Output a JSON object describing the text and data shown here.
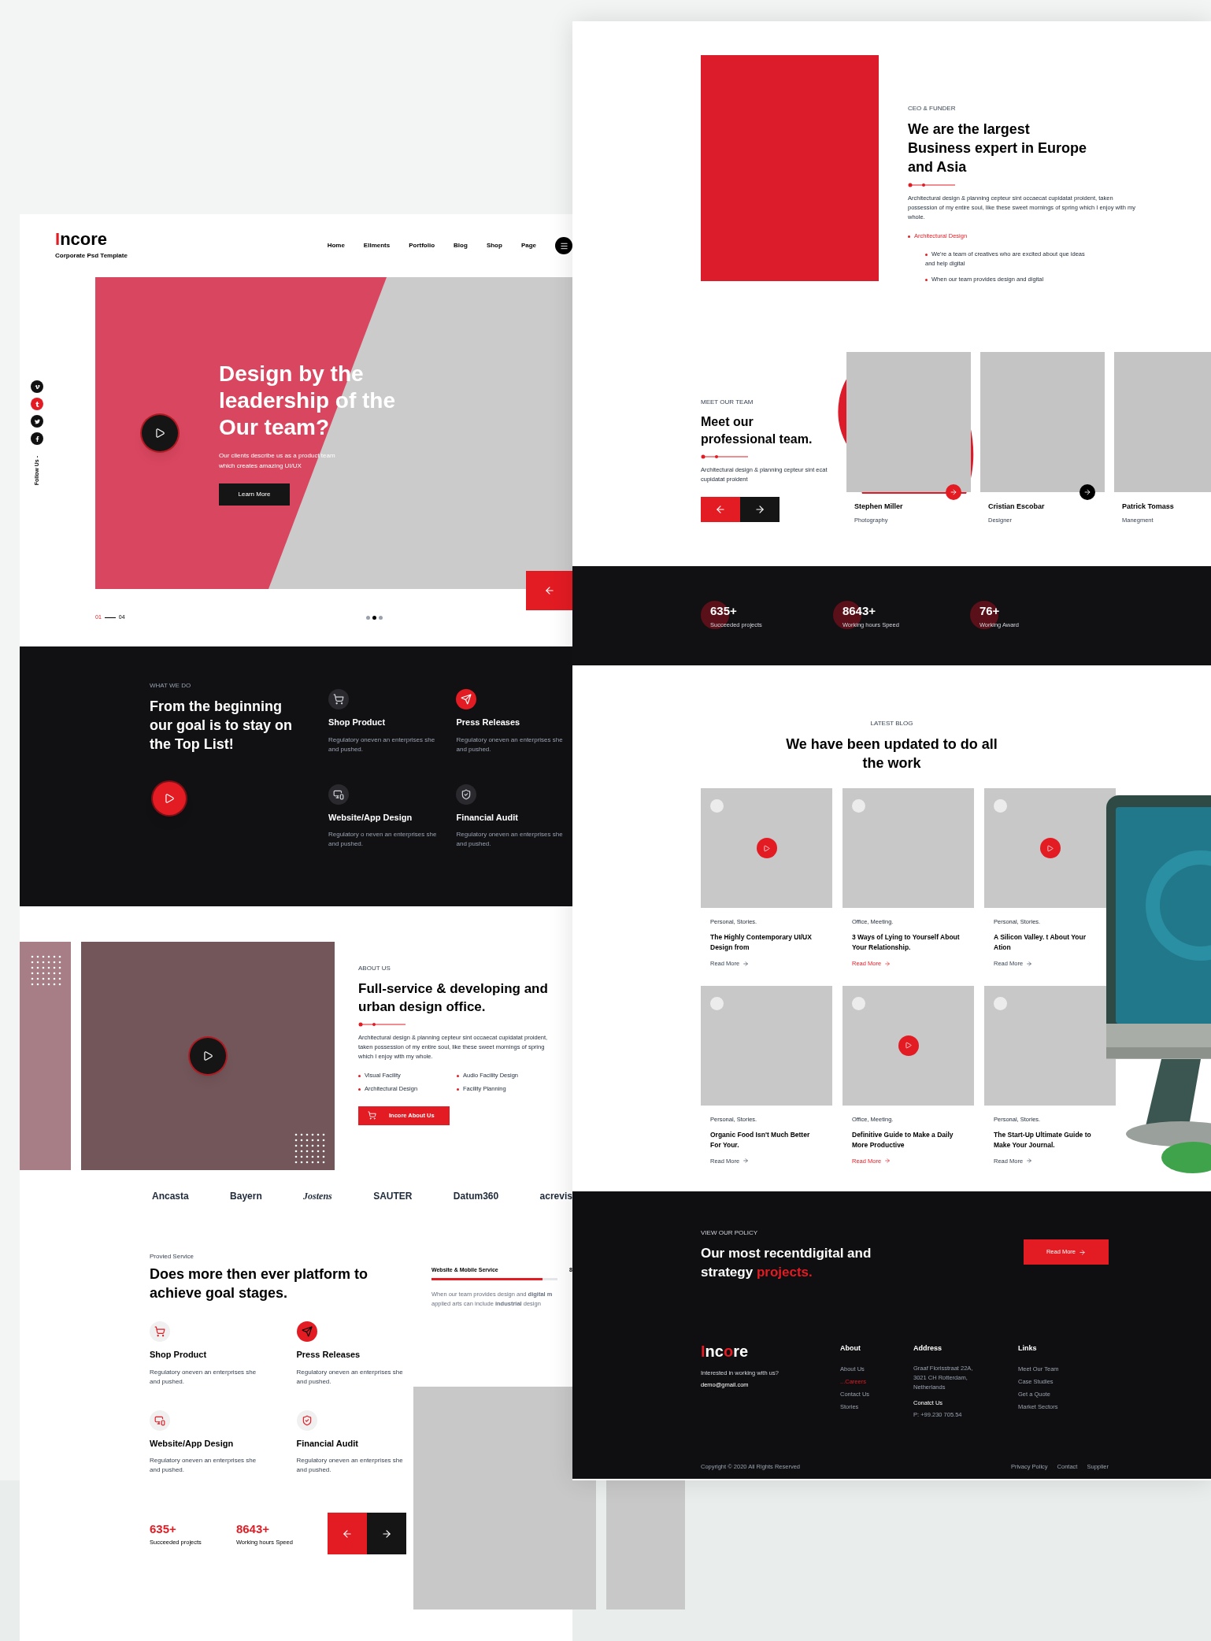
{
  "left_page": {
    "header": {
      "logo": "Incore",
      "tagline": "Corporate Psd Template",
      "nav": [
        "Home",
        "Ellments",
        "Portfolio",
        "Blog",
        "Shop",
        "Page"
      ]
    },
    "social": {
      "label": "Follow Us -",
      "icons": [
        {
          "kind": "vimeo",
          "color": "#111111"
        },
        {
          "kind": "tumblr",
          "color": "#e31b23"
        },
        {
          "kind": "twitter",
          "color": "#111111"
        },
        {
          "kind": "facebook",
          "color": "#111111"
        }
      ]
    },
    "hero": {
      "title": "Design by the leadership of the Our team?",
      "text": "Our clients describe us as a product team which creates amazing UI/UX",
      "button": "Learn More",
      "pager_current": "01",
      "pager_total": "04",
      "dots": [
        {
          "selected": false
        },
        {
          "selected": true
        },
        {
          "selected": false
        }
      ]
    },
    "what_we_do": {
      "eyebrow": "WHAT WE DO",
      "title": "From the beginning our goal is to stay on the Top List!",
      "services": [
        {
          "kind": "cart",
          "title": "Shop Product",
          "text": "Regulatory oneven an enterprises she and pushed.",
          "selected": false
        },
        {
          "kind": "plane",
          "title": "Press Releases",
          "text": "Regulatory oneven an enterprises she and pushed.",
          "selected": true
        },
        {
          "kind": "devices",
          "title": "Website/App Design",
          "text": "Regulatory o neven an enterprises she and pushed.",
          "selected": false
        },
        {
          "kind": "shield",
          "title": "Financial Audit",
          "text": "Regulatory oneven an enterprises she and pushed.",
          "selected": false
        }
      ]
    },
    "about": {
      "eyebrow": "ABOUT US",
      "title": "Full-service & developing and urban design office.",
      "text": "Architectural design & planning cepteur sint occaecat cupidatat proident, taken possession of my entire soul, like these sweet mornings of spring which I enjoy with my whole.",
      "bullets": [
        "Visual Facility",
        "Audio Facility Design",
        "Architectural Design",
        "Facility Planning"
      ],
      "button": "Incore About Us"
    },
    "partners": [
      "Ancasta",
      "Bayern",
      "Jostens",
      "SAUTER",
      "Datum360",
      "acrevis"
    ],
    "service": {
      "eyebrow": "Provied Service",
      "title": "Does more then ever platform to achieve goal stages.",
      "services": [
        {
          "kind": "cart",
          "title": "Shop Product",
          "text": "Regulatory oneven an enterprises she and pushed.",
          "selected": false
        },
        {
          "kind": "plane",
          "title": "Press Releases",
          "text": "Regulatory oneven an enterprises she and pushed.",
          "selected": true
        },
        {
          "kind": "devices",
          "title": "Website/App Design",
          "text": "Regulatory oneven an enterprises she and pushed.",
          "selected": false
        },
        {
          "kind": "shield",
          "title": "Financial Audit",
          "text": "Regulatory oneven an enterprises she and pushed.",
          "selected": false
        }
      ],
      "progress": {
        "label": "Website & Mobile Service",
        "reading": "8",
        "level": 0.88
      },
      "progress_text": "When our team provides design and **digital m** applied arts can include **industrial** design",
      "stats": [
        {
          "value": "635+",
          "label": "Succeeded projects"
        },
        {
          "value": "8643+",
          "label": "Working hours Speed"
        }
      ]
    }
  },
  "right_page": {
    "ceo": {
      "eyebrow": "CEO & FUNDER",
      "title": "We are the largest Business expert in Europe and Asia",
      "text": "Architectural design & planning cepteur sint occaecat cupidatat proident, taken possession of my entire soul, like these sweet mornings of spring which I enjoy with my whole.",
      "list": [
        {
          "text": "Architectural Design",
          "selected": true,
          "children": [
            {
              "text": "We're a team of creatives who are excited about que ideas and help digital",
              "selected": false
            },
            {
              "text": "When our team provides design and digital",
              "selected": false
            }
          ]
        }
      ]
    },
    "team": {
      "eyebrow": "MEET OUR TEAM",
      "title": "Meet our professional team.",
      "text": "Architectural design & planning cepteur sint ecat cupidatat proident",
      "members": [
        {
          "name": "Stephen Miller",
          "role": "Photography",
          "selected": true
        },
        {
          "name": "Cristian Escobar",
          "role": "Designer",
          "selected": false
        },
        {
          "name": "Patrick Tomass",
          "role": "Manegment"
        }
      ]
    },
    "stats": [
      {
        "value": "635+",
        "label": "Succeeded projects"
      },
      {
        "value": "8643+",
        "label": "Working hours Speed"
      },
      {
        "value": "76+",
        "label": "Working Award"
      }
    ],
    "blog": {
      "eyebrow": "LATEST BLOG",
      "title": "We have been updated to do all the work",
      "posts": [
        {
          "category": "Personal, Stories.",
          "title": "The Highly Contemporary UI/UX Design from",
          "read_more": "Read More",
          "video": true,
          "selected": false
        },
        {
          "category": "Office, Meeting.",
          "title": "3 Ways of Lying to Yourself About Your Relationship.",
          "read_more": "Read More",
          "video": false,
          "selected": true
        },
        {
          "category": "Personal, Stories.",
          "title": "A Silicon Valley. t About Your Ation",
          "read_more": "Read More",
          "video": true,
          "selected": false
        },
        {
          "category": "Personal, Stories.",
          "title": "Organic Food Isn't Much Better For Your.",
          "read_more": "Read More",
          "video": false,
          "selected": false
        },
        {
          "category": "Office, Meeting.",
          "title": "Definitive Guide to Make a Daily More Productive",
          "read_more": "Read More",
          "video": true,
          "selected": true
        },
        {
          "category": "Personal, Stories.",
          "title": "The Start-Up Ultimate Guide to Make Your Journal.",
          "read_more": "Read More",
          "video": false,
          "selected": false
        }
      ]
    },
    "policy": {
      "eyebrow": "VIEW OUR POLICY",
      "title": "Our most recentdigital and strategy",
      "title_accent": "projects.",
      "button": "Read More"
    },
    "footer": {
      "logo": "Incore",
      "text": "Interested in working with us?",
      "email": "demo@gmail.com",
      "about": {
        "heading": "About",
        "links": [
          {
            "text": "About Us",
            "selected": false
          },
          {
            "text": "...Careers",
            "selected": true
          },
          {
            "text": "Contact Us",
            "selected": false
          },
          {
            "text": "Stories",
            "selected": false
          }
        ]
      },
      "address": {
        "heading": "Address",
        "lines": "Graaf Florisstraat 22A, 3021 CH Rotterdam, Netherlands",
        "contact_heading": "Conatct Us",
        "phone": "P: +99.230 705.54"
      },
      "links": {
        "heading": "Links",
        "items": [
          "Meet Our Team",
          "Case Studies",
          "Get a Quote",
          "Market Sectors"
        ]
      },
      "copyright": "Copyright © 2020 All Rights Reserved",
      "bottom_links": [
        "Privacy Policy",
        "Contact",
        "Supplier"
      ]
    }
  }
}
